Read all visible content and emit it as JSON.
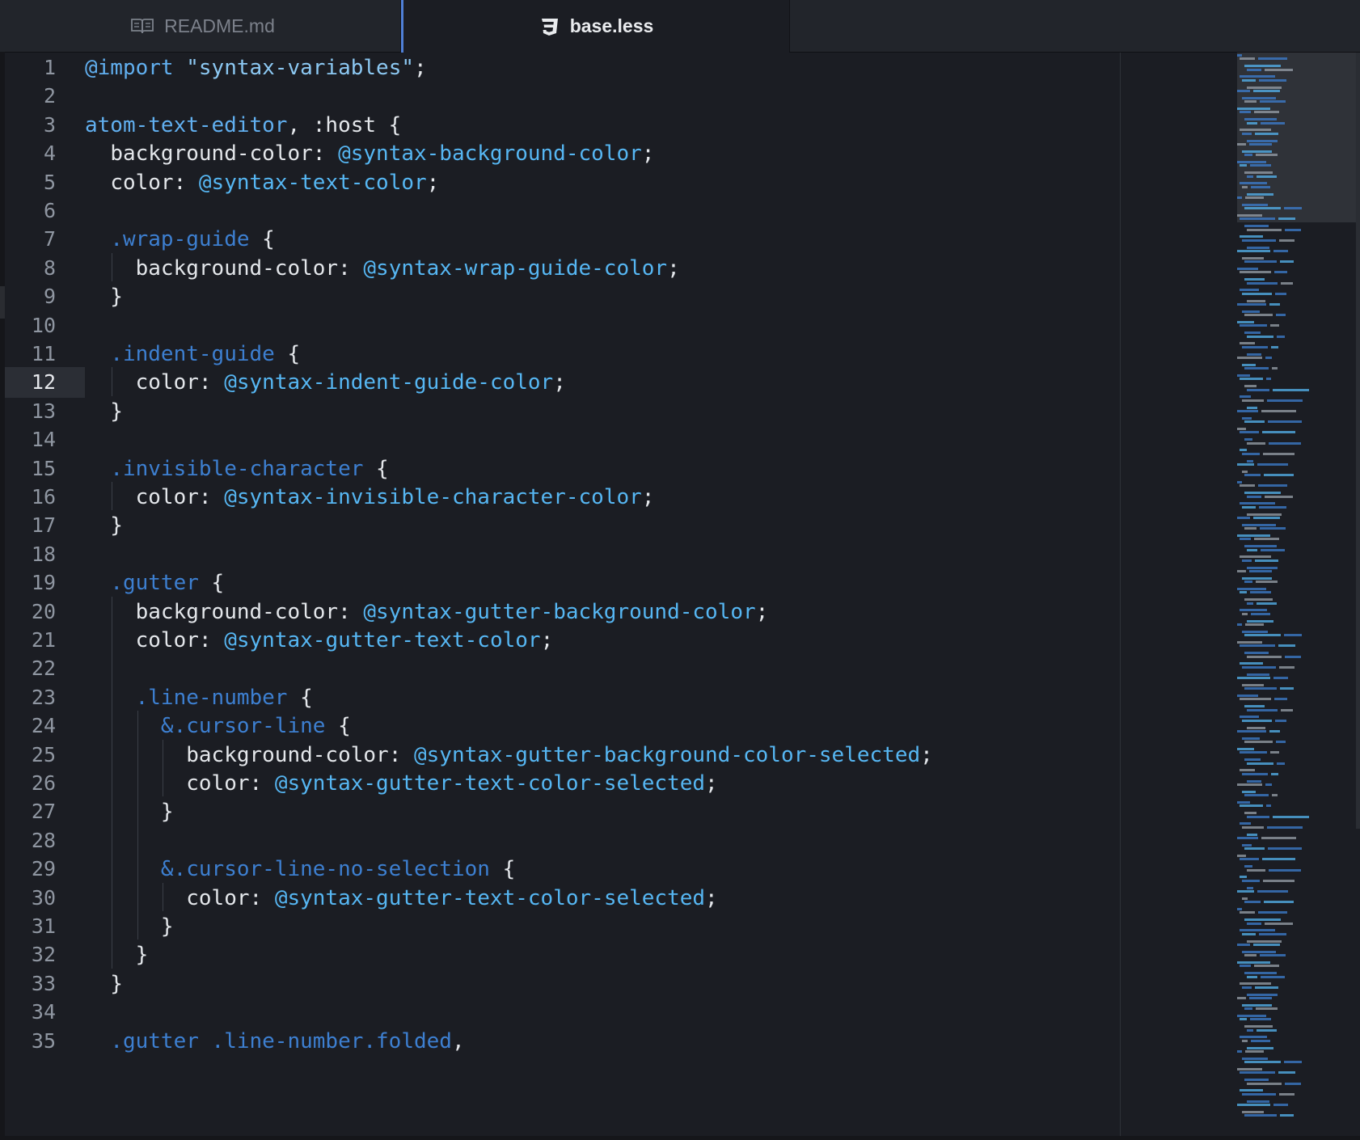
{
  "tabs": [
    {
      "label": "README.md",
      "icon": "book-icon",
      "active": false
    },
    {
      "label": "base.less",
      "icon": "css3-icon",
      "active": true
    }
  ],
  "editor": {
    "cursor_line": 12,
    "lines": [
      [
        [
          "import",
          "@import"
        ],
        [
          "punc",
          " "
        ],
        [
          "string",
          "\"syntax-variables\""
        ],
        [
          "punc",
          ";"
        ]
      ],
      [],
      [
        [
          "tag",
          "atom-text-editor"
        ],
        [
          "punc",
          ", :host {"
        ]
      ],
      [
        [
          "punc",
          "  "
        ],
        [
          "prop",
          "background-color"
        ],
        [
          "punc",
          ": "
        ],
        [
          "var",
          "@syntax-background-color"
        ],
        [
          "punc",
          ";"
        ]
      ],
      [
        [
          "punc",
          "  "
        ],
        [
          "prop",
          "color"
        ],
        [
          "punc",
          ": "
        ],
        [
          "var",
          "@syntax-text-color"
        ],
        [
          "punc",
          ";"
        ]
      ],
      [],
      [
        [
          "punc",
          "  "
        ],
        [
          "class",
          ".wrap-guide"
        ],
        [
          "punc",
          " {"
        ]
      ],
      [
        [
          "punc",
          "    "
        ],
        [
          "prop",
          "background-color"
        ],
        [
          "punc",
          ": "
        ],
        [
          "var",
          "@syntax-wrap-guide-color"
        ],
        [
          "punc",
          ";"
        ]
      ],
      [
        [
          "punc",
          "  }"
        ]
      ],
      [],
      [
        [
          "punc",
          "  "
        ],
        [
          "class",
          ".indent-guide"
        ],
        [
          "punc",
          " {"
        ]
      ],
      [
        [
          "punc",
          "    "
        ],
        [
          "prop",
          "color"
        ],
        [
          "punc",
          ": "
        ],
        [
          "var",
          "@syntax-indent-guide-color"
        ],
        [
          "punc",
          ";"
        ]
      ],
      [
        [
          "punc",
          "  }"
        ]
      ],
      [],
      [
        [
          "punc",
          "  "
        ],
        [
          "class",
          ".invisible-character"
        ],
        [
          "punc",
          " {"
        ]
      ],
      [
        [
          "punc",
          "    "
        ],
        [
          "prop",
          "color"
        ],
        [
          "punc",
          ": "
        ],
        [
          "var",
          "@syntax-invisible-character-color"
        ],
        [
          "punc",
          ";"
        ]
      ],
      [
        [
          "punc",
          "  }"
        ]
      ],
      [],
      [
        [
          "punc",
          "  "
        ],
        [
          "class",
          ".gutter"
        ],
        [
          "punc",
          " {"
        ]
      ],
      [
        [
          "punc",
          "    "
        ],
        [
          "prop",
          "background-color"
        ],
        [
          "punc",
          ": "
        ],
        [
          "var",
          "@syntax-gutter-background-color"
        ],
        [
          "punc",
          ";"
        ]
      ],
      [
        [
          "punc",
          "    "
        ],
        [
          "prop",
          "color"
        ],
        [
          "punc",
          ": "
        ],
        [
          "var",
          "@syntax-gutter-text-color"
        ],
        [
          "punc",
          ";"
        ]
      ],
      [],
      [
        [
          "punc",
          "    "
        ],
        [
          "class",
          ".line-number"
        ],
        [
          "punc",
          " {"
        ]
      ],
      [
        [
          "punc",
          "      "
        ],
        [
          "class",
          "&.cursor-line"
        ],
        [
          "punc",
          " {"
        ]
      ],
      [
        [
          "punc",
          "        "
        ],
        [
          "prop",
          "background-color"
        ],
        [
          "punc",
          ": "
        ],
        [
          "var",
          "@syntax-gutter-background-color-selected"
        ],
        [
          "punc",
          ";"
        ]
      ],
      [
        [
          "punc",
          "        "
        ],
        [
          "prop",
          "color"
        ],
        [
          "punc",
          ": "
        ],
        [
          "var",
          "@syntax-gutter-text-color-selected"
        ],
        [
          "punc",
          ";"
        ]
      ],
      [
        [
          "punc",
          "      }"
        ]
      ],
      [],
      [
        [
          "punc",
          "      "
        ],
        [
          "class",
          "&.cursor-line-no-selection"
        ],
        [
          "punc",
          " {"
        ]
      ],
      [
        [
          "punc",
          "        "
        ],
        [
          "prop",
          "color"
        ],
        [
          "punc",
          ": "
        ],
        [
          "var",
          "@syntax-gutter-text-color-selected"
        ],
        [
          "punc",
          ";"
        ]
      ],
      [
        [
          "punc",
          "      }"
        ]
      ],
      [
        [
          "punc",
          "    }"
        ]
      ],
      [
        [
          "punc",
          "  }"
        ]
      ],
      [],
      [
        [
          "punc",
          "  "
        ],
        [
          "class",
          ".gutter .line-number.folded"
        ],
        [
          "punc",
          ","
        ]
      ]
    ]
  },
  "colors": {
    "background": "#1b1d23",
    "import": "#61afef",
    "variable": "#56b6f2",
    "class_selector": "#3d7fd0",
    "text": "#e3e6ea",
    "accent": "#4f7fd6"
  }
}
